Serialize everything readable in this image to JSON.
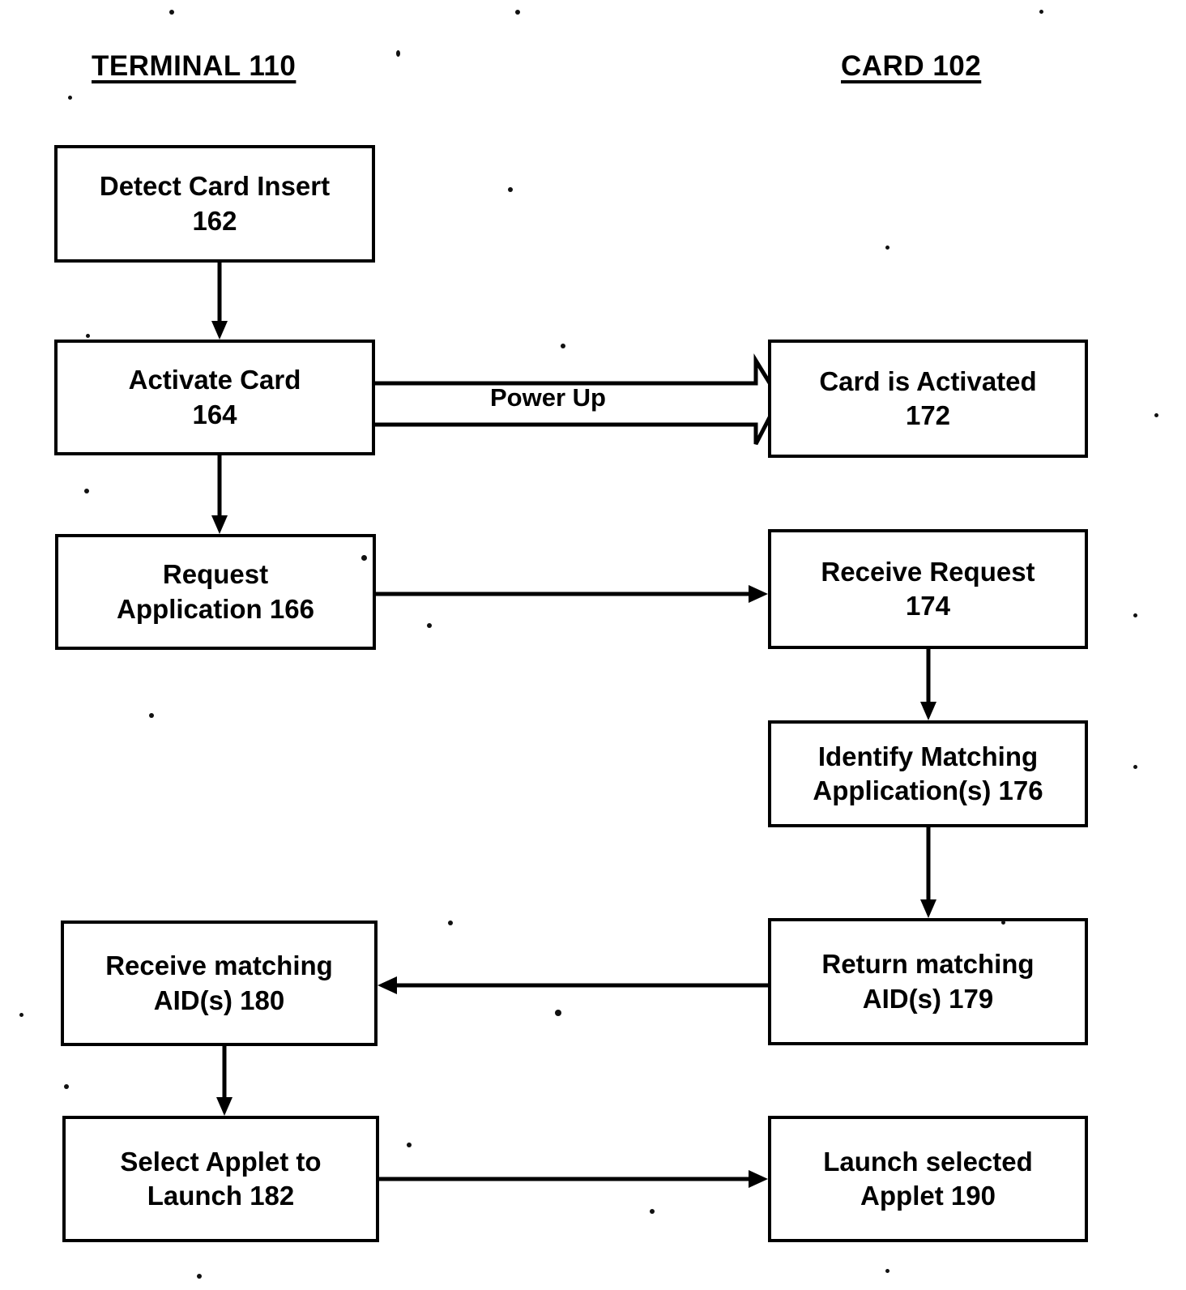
{
  "figure": {
    "title": "Card/terminal applet selection flowchart",
    "columns": [
      {
        "id": "terminal",
        "heading": "TERMINAL 110"
      },
      {
        "id": "card",
        "heading": "CARD 102"
      }
    ],
    "ink_color": "#000000",
    "paper_color": "#ffffff"
  },
  "nodes": {
    "n162": {
      "line1": "Detect Card Insert",
      "line2": "162",
      "ref": "162",
      "column": "terminal"
    },
    "n164": {
      "line1": "Activate Card",
      "line2": "164",
      "ref": "164",
      "column": "terminal"
    },
    "n166": {
      "line1": "Request",
      "line2": "Application 166",
      "ref": "166",
      "column": "terminal"
    },
    "n180": {
      "line1": "Receive matching",
      "line2": "AID(s) 180",
      "ref": "180",
      "column": "terminal"
    },
    "n182": {
      "line1": "Select Applet to",
      "line2": "Launch 182",
      "ref": "182",
      "column": "terminal"
    },
    "n172": {
      "line1": "Card is Activated",
      "line2": "172",
      "ref": "172",
      "column": "card"
    },
    "n174": {
      "line1": "Receive Request",
      "line2": "174",
      "ref": "174",
      "column": "card"
    },
    "n176": {
      "line1": "Identify Matching",
      "line2": "Application(s) 176",
      "ref": "176",
      "column": "card"
    },
    "n179": {
      "line1": "Return matching",
      "line2": "AID(s) 179",
      "ref": "179",
      "column": "card"
    },
    "n190": {
      "line1": "Launch selected",
      "line2": "Applet 190",
      "ref": "190",
      "column": "card"
    }
  },
  "edges": {
    "e_162_164": {
      "from": "162",
      "to": "164",
      "label": "",
      "style": "solid-arrow",
      "direction": "down"
    },
    "e_164_172": {
      "from": "164",
      "to": "172",
      "label": "Power Up",
      "style": "block-arrow",
      "direction": "right"
    },
    "e_164_166": {
      "from": "164",
      "to": "166",
      "label": "",
      "style": "solid-arrow",
      "direction": "down"
    },
    "e_166_174": {
      "from": "166",
      "to": "174",
      "label": "",
      "style": "solid-arrow",
      "direction": "right"
    },
    "e_174_176": {
      "from": "174",
      "to": "176",
      "label": "",
      "style": "solid-arrow",
      "direction": "down"
    },
    "e_176_179": {
      "from": "176",
      "to": "179",
      "label": "",
      "style": "solid-arrow",
      "direction": "down"
    },
    "e_179_180": {
      "from": "179",
      "to": "180",
      "label": "",
      "style": "solid-arrow",
      "direction": "left"
    },
    "e_180_182": {
      "from": "180",
      "to": "182",
      "label": "",
      "style": "solid-arrow",
      "direction": "down"
    },
    "e_182_190": {
      "from": "182",
      "to": "190",
      "label": "",
      "style": "solid-arrow",
      "direction": "right"
    }
  }
}
